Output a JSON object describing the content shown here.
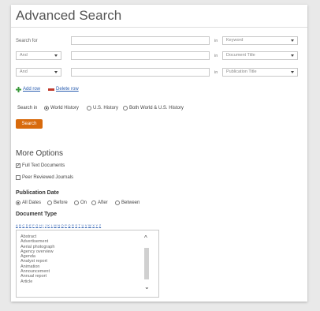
{
  "page": {
    "title": "Advanced Search"
  },
  "search_rows": [
    {
      "label": "Search for",
      "value": "",
      "in_label": "in",
      "field": "Keyword"
    },
    {
      "operator": "And",
      "value": "",
      "in_label": "in",
      "field": "Document Title"
    },
    {
      "operator": "And",
      "value": "",
      "in_label": "in",
      "field": "Publication Title"
    }
  ],
  "row_actions": {
    "add": "Add row",
    "delete": "Delete row"
  },
  "search_in": {
    "label": "Search in",
    "options": [
      "World History",
      "U.S. History",
      "Both World & U.S. History"
    ],
    "selected": "World History"
  },
  "search_button": "Search",
  "more_options": {
    "title": "More Options",
    "checkboxes": [
      {
        "label": "Full Text Documents",
        "checked": true
      },
      {
        "label": "Peer Reviewed Journals",
        "checked": false
      }
    ]
  },
  "publication_date": {
    "title": "Publication Date",
    "options": [
      "All Dates",
      "Before",
      "On",
      "After",
      "Between"
    ],
    "selected": "All Dates"
  },
  "document_type": {
    "title": "Document Type",
    "alphabet": [
      "A",
      "B",
      "C",
      "D",
      "E",
      "F",
      "G",
      "H",
      "I",
      "J",
      "K",
      "L",
      "M",
      "N",
      "O",
      "P",
      "Q",
      "R",
      "S",
      "T",
      "U",
      "V",
      "W",
      "X",
      "Y",
      "Z"
    ],
    "items": [
      "Abstract",
      "Advertisement",
      "Aerial photograph",
      "Agency overview",
      "Agenda",
      "Analyst report",
      "Animation",
      "Announcement",
      "Annual report",
      "Article"
    ]
  },
  "colors": {
    "accent": "#d86a0c",
    "link": "#2a5db0",
    "add_icon": "#3a9a3a",
    "delete_icon": "#c0392b"
  },
  "icons": {
    "add": "plus-icon",
    "delete": "minus-icon",
    "dropdown": "chevron-down-icon",
    "scroll_up": "chevron-up-icon",
    "scroll_down": "chevron-down-icon"
  }
}
